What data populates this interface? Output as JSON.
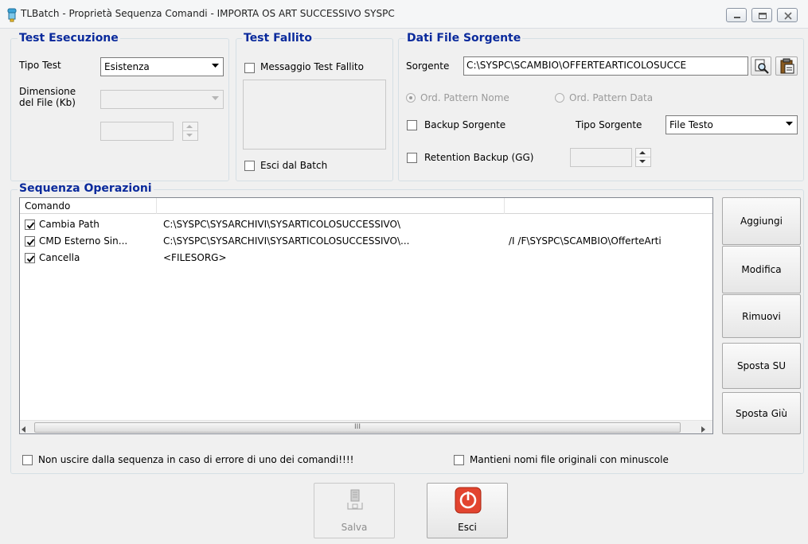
{
  "window": {
    "title": "TLBatch - Proprietà Sequenza Comandi - IMPORTA OS ART SUCCESSIVO SYSPC"
  },
  "test_esecuzione": {
    "title": "Test Esecuzione",
    "tipo_test_label": "Tipo Test",
    "tipo_test_value": "Esistenza",
    "dimensione_label_line1": "Dimensione",
    "dimensione_label_line2": "del File (Kb)",
    "dimensione_value": "",
    "spin_value": ""
  },
  "test_fallito": {
    "title": "Test Fallito",
    "messaggio_label": "Messaggio Test Fallito",
    "messaggio_checked": false,
    "message_text": "",
    "esci_label": "Esci dal Batch",
    "esci_checked": false
  },
  "dati_file": {
    "title": "Dati File Sorgente",
    "sorgente_label": "Sorgente",
    "sorgente_value": "C:\\SYSPC\\SCAMBIO\\OFFERTEARTICOLOSUCCE",
    "ord_nome_label": "Ord. Pattern  Nome",
    "ord_nome_selected": true,
    "ord_data_label": "Ord. Pattern  Data",
    "ord_data_selected": false,
    "backup_label": "Backup Sorgente",
    "backup_checked": false,
    "tipo_sorgente_label": "Tipo Sorgente",
    "tipo_sorgente_value": "File Testo",
    "retention_label": "Retention Backup (GG)",
    "retention_checked": false,
    "retention_value": ""
  },
  "sequenza": {
    "title": "Sequenza Operazioni",
    "columns": [
      "Comando",
      "",
      ""
    ],
    "rows": [
      {
        "checked": true,
        "comando": "Cambia Path",
        "param1": "C:\\SYSPC\\SYSARCHIVI\\SYSARTICOLOSUCCESSIVO\\",
        "param2": ""
      },
      {
        "checked": true,
        "comando": "CMD Esterno Sin...",
        "param1": "C:\\SYSPC\\SYSARCHIVI\\SYSARTICOLOSUCCESSIVO\\...",
        "param2": "/I /F\\SYSPC\\SCAMBIO\\OfferteArti"
      },
      {
        "checked": true,
        "comando": "Cancella",
        "param1": "<FILESORG>",
        "param2": ""
      }
    ],
    "scroll_thumb_glyph": "III",
    "buttons": {
      "aggiungi": "Aggiungi",
      "modifica": "Modifica",
      "rimuovi": "Rimuovi",
      "sposta_su": "Sposta SU",
      "sposta_giu": "Sposta Giù"
    }
  },
  "options": {
    "non_uscire_label": "Non uscire dalla sequenza in caso di errore di uno dei comandi!!!!",
    "non_uscire_checked": false,
    "mantieni_label": "Mantieni nomi file originali con minuscole",
    "mantieni_checked": false
  },
  "footer": {
    "salva_label": "Salva",
    "esci_label": "Esci"
  },
  "colors": {
    "group_title": "#0a2a9c",
    "exit_icon_red": "#e2442f"
  }
}
